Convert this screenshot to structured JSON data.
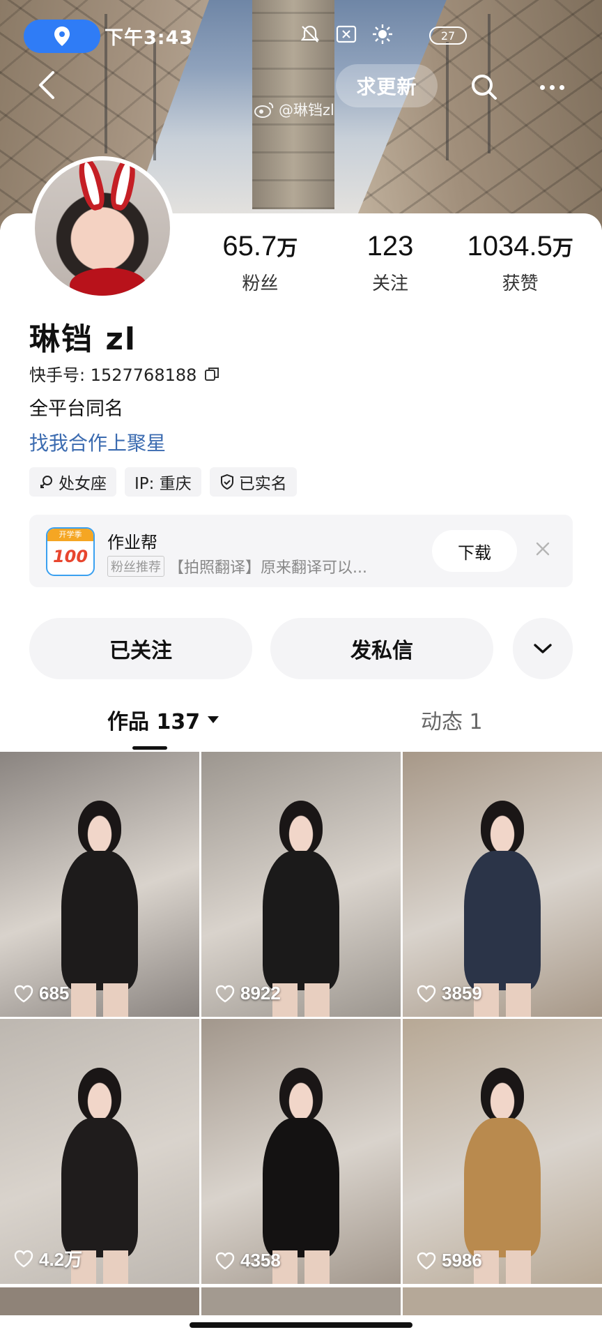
{
  "status_bar": {
    "time": "下午3:43",
    "battery": "27",
    "icons": [
      "location-icon",
      "mute-bell-icon",
      "close-box-icon",
      "brightness-icon"
    ]
  },
  "nav": {
    "update_label": "求更新",
    "watermark": "@琳铛zl"
  },
  "profile": {
    "stats": [
      {
        "num": "65.7",
        "unit": "万",
        "label": "粉丝"
      },
      {
        "num": "123",
        "unit": "",
        "label": "关注"
      },
      {
        "num": "1034.5",
        "unit": "万",
        "label": "获赞"
      }
    ],
    "nickname": "琳铛 zl",
    "kwai_id": "快手号: 1527768188",
    "bio": "全平台同名",
    "collab_link": "找我合作上聚星",
    "tags": [
      {
        "icon": "constellation-icon",
        "label": "处女座"
      },
      {
        "icon": "",
        "label": "IP: 重庆"
      },
      {
        "icon": "verified-shield-icon",
        "label": "已实名"
      }
    ]
  },
  "ad": {
    "logo_top": "开学季",
    "logo_num": "100",
    "title": "作业帮",
    "badge": "粉丝推荐",
    "desc": "【拍照翻译】原来翻译可以...",
    "download": "下载"
  },
  "actions": {
    "followed": "已关注",
    "message": "发私信"
  },
  "tabs": {
    "works": "作品 137",
    "moments": "动态 1"
  },
  "grid": [
    {
      "likes": "685",
      "bg": "#8a8480",
      "outfit": "#1d1b1b"
    },
    {
      "likes": "8922",
      "bg": "#9c968f",
      "outfit": "#1b1a1a"
    },
    {
      "likes": "3859",
      "bg": "#a79888",
      "outfit": "#2b3448"
    },
    {
      "likes": "4.2万",
      "bg": "#bdb7b0",
      "outfit": "#1f1c1c"
    },
    {
      "likes": "4358",
      "bg": "#a2978c",
      "outfit": "#141212"
    },
    {
      "likes": "5986",
      "bg": "#b7a895",
      "outfit": "#b98a4e"
    }
  ]
}
